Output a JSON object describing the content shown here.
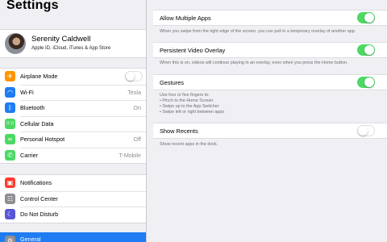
{
  "sidebar": {
    "title": "Settings",
    "profile": {
      "name": "Serenity Caldwell",
      "subtitle": "Apple ID, iCloud, iTunes & App Store"
    },
    "group1": [
      {
        "label": "Airplane Mode",
        "icon": "airplane-icon",
        "color": "#ff9500",
        "glyph": "✈",
        "toggle": false
      },
      {
        "label": "Wi-Fi",
        "icon": "wifi-icon",
        "color": "#1f7cf2",
        "glyph": "◠",
        "value": "Tesla"
      },
      {
        "label": "Bluetooth",
        "icon": "bluetooth-icon",
        "color": "#1f7cf2",
        "glyph": "ᛒ",
        "value": "On"
      },
      {
        "label": "Cellular Data",
        "icon": "cellular-icon",
        "color": "#4cd964",
        "glyph": "((·))"
      },
      {
        "label": "Personal Hotspot",
        "icon": "hotspot-icon",
        "color": "#4cd964",
        "glyph": "∞",
        "value": "Off"
      },
      {
        "label": "Carrier",
        "icon": "phone-icon",
        "color": "#4cd964",
        "glyph": "✆",
        "value": "T-Mobile"
      }
    ],
    "group2": [
      {
        "label": "Notifications",
        "icon": "notifications-icon",
        "color": "#ff3b30",
        "glyph": "▣"
      },
      {
        "label": "Control Center",
        "icon": "control-center-icon",
        "color": "#8e8e93",
        "glyph": "☷"
      },
      {
        "label": "Do Not Disturb",
        "icon": "moon-icon",
        "color": "#5856d6",
        "glyph": "☾"
      }
    ],
    "selected": {
      "label": "General",
      "icon": "gear-icon",
      "glyph": "⚙"
    }
  },
  "detail": {
    "allow_multiple_apps": {
      "label": "Allow Multiple Apps",
      "on": true,
      "footnote": "When you swipe from the right edge of the screen, you can pull in a temporary overlay of another app."
    },
    "persistent_video": {
      "label": "Persistent Video Overlay",
      "on": true,
      "footnote": "When this is on, videos will continue playing in an overlay, even when you press the Home button."
    },
    "gestures": {
      "label": "Gestures",
      "on": true,
      "footnote_lines": [
        "Use four or five fingers to:",
        "• Pinch to the Home Screen",
        "• Swipe up to the App Switcher",
        "• Swipe left or right between apps"
      ]
    },
    "show_recents": {
      "label": "Show Recents",
      "on": false,
      "footnote": "Show recent apps in the dock."
    }
  },
  "colors": {
    "accent": "#1f7cf2",
    "toggle_on": "#4cd964"
  }
}
